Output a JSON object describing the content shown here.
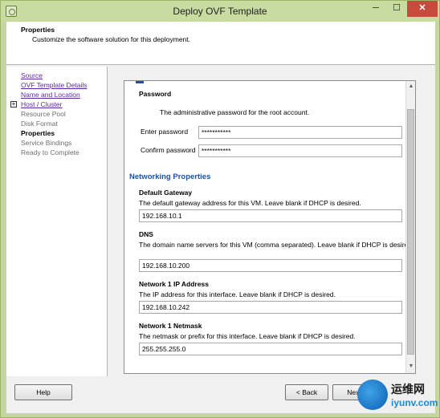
{
  "window": {
    "title": "Deploy OVF Template",
    "close_glyph": "✕",
    "min_glyph": "─",
    "max_glyph": "☐"
  },
  "header": {
    "title": "Properties",
    "subtitle": "Customize the software solution for this deployment."
  },
  "nav": {
    "items": [
      {
        "label": "Source",
        "state": "link"
      },
      {
        "label": "OVF Template Details",
        "state": "link"
      },
      {
        "label": "Name and Location",
        "state": "link"
      },
      {
        "label": "Host / Cluster",
        "state": "link"
      },
      {
        "label": "Resource Pool",
        "state": "disabled"
      },
      {
        "label": "Disk Format",
        "state": "disabled"
      },
      {
        "label": "Properties",
        "state": "active"
      },
      {
        "label": "Service Bindings",
        "state": "disabled"
      },
      {
        "label": "Ready to Complete",
        "state": "disabled"
      }
    ],
    "expand_glyph": "+"
  },
  "form": {
    "password": {
      "title": "Password",
      "description": "The administrative password for the root account.",
      "enter_label": "Enter password",
      "enter_value": "***********",
      "confirm_label": "Confirm password",
      "confirm_value": "***********"
    },
    "networking": {
      "title": "Networking Properties",
      "gateway": {
        "title": "Default Gateway",
        "description": "The default gateway address for this VM. Leave blank if DHCP is desired.",
        "value": "192.168.10.1"
      },
      "dns": {
        "title": "DNS",
        "description": "The domain name servers for this VM (comma separated). Leave blank if DHCP is desired.",
        "value": "192.168.10.200"
      },
      "ip": {
        "title": "Network 1 IP Address",
        "description": "The IP address for this interface. Leave blank if DHCP is desired.",
        "value": "192.168.10.242"
      },
      "netmask": {
        "title": "Network 1 Netmask",
        "description": "The netmask or prefix for this interface. Leave blank if DHCP is desired.",
        "value": "255.255.255.0"
      }
    }
  },
  "footer": {
    "help_label": "Help",
    "back_label": "< Back",
    "next_label": "Next"
  },
  "watermark": {
    "line1": "运维网",
    "line2": "iyunv.com"
  },
  "colors": {
    "link": "#5a2aa6",
    "section_title": "#1f4fa8",
    "title_bar": "#c8dca2",
    "close_button": "#c74b3d"
  }
}
